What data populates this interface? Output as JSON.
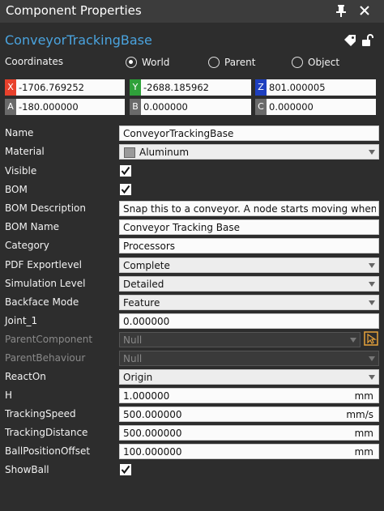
{
  "window": {
    "title": "Component Properties"
  },
  "component": {
    "name": "ConveyorTrackingBase"
  },
  "coordinates": {
    "label": "Coordinates",
    "options": [
      "World",
      "Parent",
      "Object"
    ],
    "selected": "World",
    "x": "-1706.769252",
    "y": "-2688.185962",
    "z": "801.000005",
    "a": "-180.000000",
    "b": "0.000000",
    "c": "0.000000",
    "axis_labels": {
      "x": "X",
      "y": "Y",
      "z": "Z",
      "a": "A",
      "b": "B",
      "c": "C"
    },
    "axis_colors": {
      "x": "#e8412c",
      "y": "#2fa13a",
      "z": "#1e3fbf",
      "abc": "#6a6a6a"
    }
  },
  "properties": [
    {
      "label": "Name",
      "value": "ConveyorTrackingBase",
      "kind": "text"
    },
    {
      "label": "Material",
      "value": "Aluminum",
      "kind": "select-swatch"
    },
    {
      "label": "Visible",
      "checked": true,
      "kind": "checkbox"
    },
    {
      "label": "BOM",
      "checked": true,
      "kind": "checkbox"
    },
    {
      "label": "BOM Description",
      "value": "Snap this to a conveyor. A node starts moving when produ",
      "kind": "text"
    },
    {
      "label": "BOM Name",
      "value": "Conveyor Tracking Base",
      "kind": "text"
    },
    {
      "label": "Category",
      "value": "Processors",
      "kind": "text"
    },
    {
      "label": "PDF Exportlevel",
      "value": "Complete",
      "kind": "select"
    },
    {
      "label": "Simulation Level",
      "value": "Detailed",
      "kind": "select"
    },
    {
      "label": "Backface Mode",
      "value": "Feature",
      "kind": "select"
    },
    {
      "label": "Joint_1",
      "value": "0.000000",
      "kind": "text"
    },
    {
      "label": "ParentComponent",
      "value": "Null",
      "kind": "select-disabled",
      "dim": true
    },
    {
      "label": "ParentBehaviour",
      "value": "Null",
      "kind": "select-disabled",
      "dim": true
    },
    {
      "label": "ReactOn",
      "value": "Origin",
      "kind": "select"
    },
    {
      "label": "H",
      "value": "1.000000",
      "unit": "mm",
      "kind": "unit"
    },
    {
      "label": "TrackingSpeed",
      "value": "500.000000",
      "unit": "mm/s",
      "kind": "unit"
    },
    {
      "label": "TrackingDistance",
      "value": "500.000000",
      "unit": "mm",
      "kind": "unit"
    },
    {
      "label": "BallPositionOffset",
      "value": "100.000000",
      "unit": "mm",
      "kind": "unit"
    },
    {
      "label": "ShowBall",
      "checked": true,
      "kind": "checkbox"
    }
  ]
}
